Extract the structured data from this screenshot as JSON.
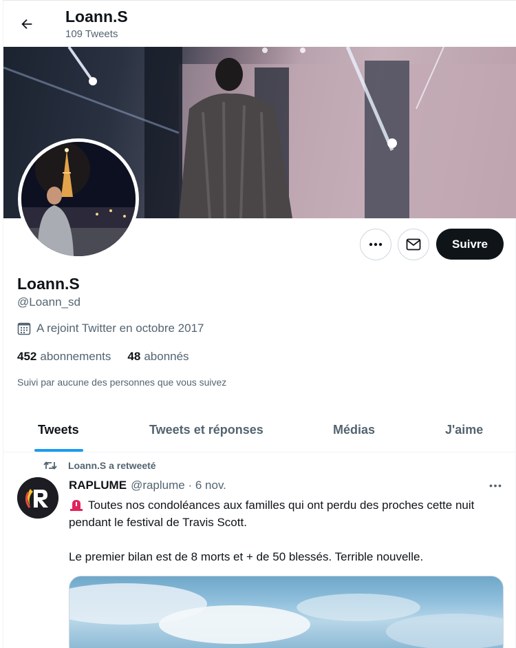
{
  "header": {
    "name": "Loann.S",
    "tweet_count": "109 Tweets",
    "back_icon": "arrow-left-icon"
  },
  "profile": {
    "display_name": "Loann.S",
    "handle": "@Loann_sd",
    "joined": "A rejoint Twitter en octobre 2017",
    "following_count": "452",
    "following_label": "abonnements",
    "followers_count": "48",
    "followers_label": "abonnés",
    "followed_by": "Suivi par aucune des personnes que vous suivez"
  },
  "actions": {
    "more_icon": "ellipsis-icon",
    "message_icon": "envelope-icon",
    "follow_label": "Suivre"
  },
  "tabs": [
    {
      "label": "Tweets",
      "active": true
    },
    {
      "label": "Tweets et réponses",
      "active": false
    },
    {
      "label": "Médias",
      "active": false
    },
    {
      "label": "J'aime",
      "active": false
    }
  ],
  "tweet": {
    "retweet_label": "Loann.S a retweeté",
    "author": "RAPLUME",
    "handle": "@raplume",
    "date": "6 nov.",
    "text_1": "Toutes nos condoléances aux familles qui ont perdu des proches cette nuit pendant le festival de Travis Scott.",
    "text_2": "Le premier bilan est de 8 morts et + de 50 blessés. Terrible nouvelle."
  },
  "colors": {
    "accent": "#1d9bf0",
    "text_primary": "#0f1419",
    "text_secondary": "#536471",
    "follow_button_bg": "#0f1419"
  }
}
